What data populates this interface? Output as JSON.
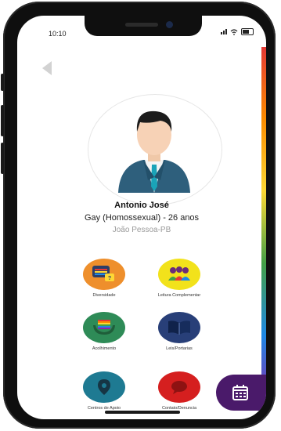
{
  "status_bar": {
    "time": "10:10"
  },
  "profile": {
    "name": "Antonio José",
    "orientation": "Gay (Homossexual) - 26 anos",
    "city": "João Pessoa-PB"
  },
  "menu": [
    {
      "label": "Diversidade",
      "color": "#ee8f2c",
      "icon": "chat-bubbles-icon"
    },
    {
      "label": "Leitura Complementar",
      "color": "#f2e21b",
      "icon": "people-group-icon"
    },
    {
      "label": "Acolhimento",
      "color": "#2e8b57",
      "icon": "hands-rainbow-icon"
    },
    {
      "label": "Leis/Portarias",
      "color": "#283f78",
      "icon": "open-book-icon"
    },
    {
      "label": "Centros de Apoio",
      "color": "#1e7a92",
      "icon": "map-pin-icon"
    },
    {
      "label": "Contato/Denuncia",
      "color": "#d51f1f",
      "icon": "speech-bubble-icon"
    }
  ],
  "fab": {
    "icon": "calendar-icon",
    "color": "#4a1a6a"
  }
}
